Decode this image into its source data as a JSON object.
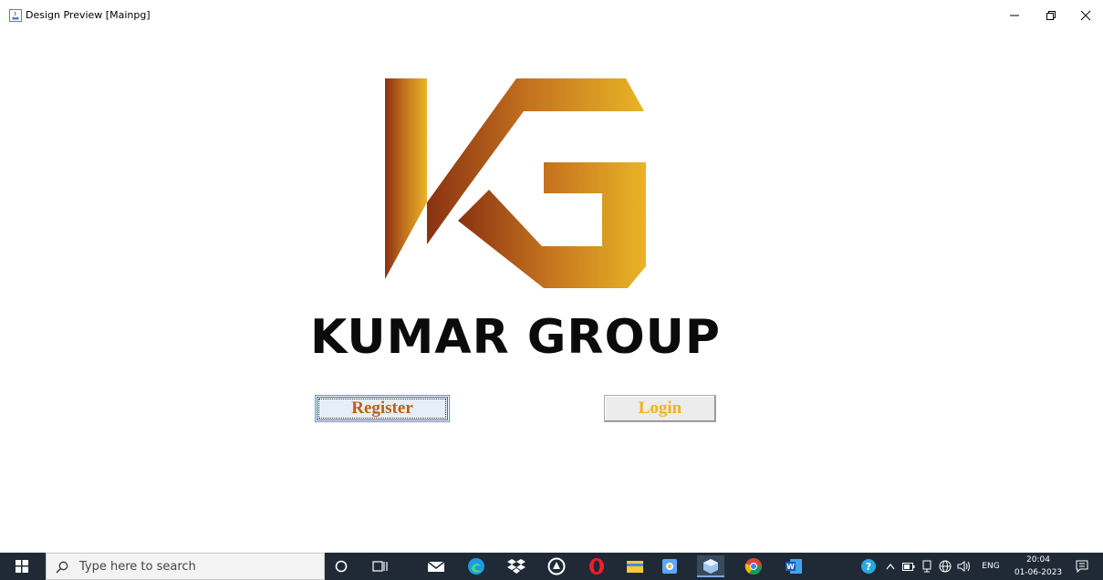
{
  "window": {
    "title": "Design Preview [Mainpg]",
    "controls": [
      "minimize-icon",
      "restore-icon",
      "close-icon"
    ]
  },
  "logo": {
    "monogram": "KG",
    "brand_name": "KUMAR GROUP",
    "gradient_colors": [
      "#8a3212",
      "#c7761f",
      "#e8b525"
    ]
  },
  "buttons": {
    "register_label": "Register",
    "login_label": "Login",
    "register_text_color": "#b8620f",
    "login_text_color": "#f3b21a"
  },
  "taskbar": {
    "search_placeholder": "Type here to search",
    "pinned_icons": [
      "cortana-icon",
      "task-view-icon",
      "mail-icon",
      "edge-icon",
      "dropbox-icon",
      "app-icon",
      "opera-icon",
      "file-explorer-icon",
      "photos-icon",
      "java-icon",
      "chrome-icon",
      "word-icon"
    ],
    "tray": {
      "language": "ENG",
      "time": "20:04",
      "date": "01-06-2023",
      "icons": [
        "help-icon",
        "chevron-up-icon",
        "battery-icon",
        "meet-icon",
        "network-icon",
        "volume-icon",
        "notification-icon"
      ]
    }
  }
}
